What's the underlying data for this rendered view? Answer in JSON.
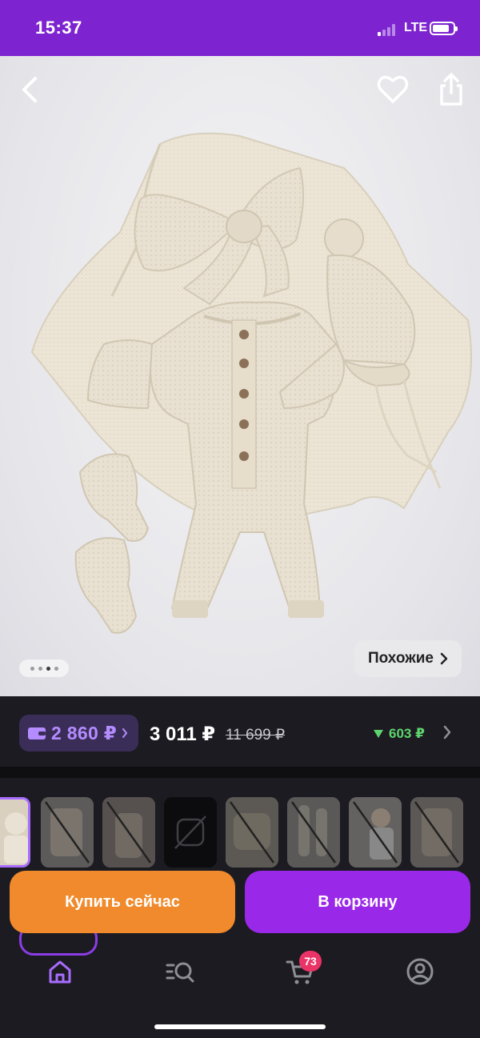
{
  "status_bar": {
    "time": "15:37",
    "network": "LTE",
    "signal_bars_filled": 1,
    "battery_level": 0.75
  },
  "product_gallery": {
    "back_icon": "chevron-left-icon",
    "favorite_icon": "heart-icon",
    "share_icon": "share-icon",
    "image_subject": "knitted-baby-outfit-photo",
    "dot_count": 4,
    "active_dot": 2,
    "similar_label": "Похожие"
  },
  "price": {
    "wallet_price": "2 860 ₽",
    "current": "3 011 ₽",
    "old": "11 699 ₽",
    "bonus": "603 ₽",
    "bonus_color": "#5fd46d",
    "wallet_color": "#b48cff"
  },
  "variants": {
    "count": 8,
    "selected_index": 0,
    "unavailable_indices": [
      1,
      2,
      3,
      4,
      5,
      6,
      7
    ]
  },
  "actions": {
    "buy_now_label": "Купить сейчас",
    "add_to_cart_label": "В корзину",
    "buy_now_color": "#f08a2c",
    "cart_color": "#9a28e8"
  },
  "bottom_nav": {
    "items": [
      {
        "icon": "home-icon",
        "active": true
      },
      {
        "icon": "catalog-search-icon",
        "active": false
      },
      {
        "icon": "cart-icon",
        "active": false
      },
      {
        "icon": "profile-icon",
        "active": false
      }
    ],
    "cart_badge": "73",
    "accent": "#a86cff"
  }
}
